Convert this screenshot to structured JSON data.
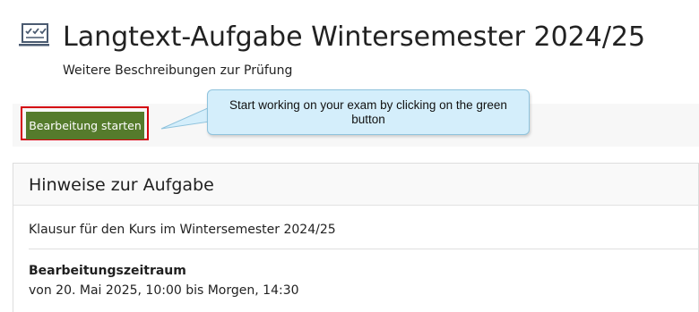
{
  "header": {
    "icon": "test-checklist-icon",
    "title": "Langtext-Aufgabe Wintersemester 2024/25",
    "subtitle": "Weitere Beschreibungen zur Prüfung"
  },
  "toolbar": {
    "start_button_label": "Bearbeitung starten",
    "highlight_color": "#d4000d",
    "button_color": "#557b2c"
  },
  "callout": {
    "text": "Start working on your exam by clicking on the green button",
    "background": "#d4eefb"
  },
  "panel": {
    "title": "Hinweise zur Aufgabe",
    "description": "Klausur für den Kurs im Wintersemester 2024/25",
    "period_label": "Bearbeitungszeitraum",
    "period_value": "von 20. Mai 2025, 10:00 bis Morgen, 14:30"
  }
}
